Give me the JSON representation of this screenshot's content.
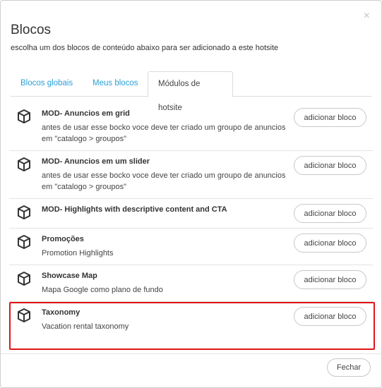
{
  "modal": {
    "close_glyph": "×",
    "title": "Blocos",
    "subtitle": "escolha um dos blocos de conteúdo abaixo para ser adicionado a este hotsite"
  },
  "tabs": [
    {
      "label": "Blocos globais",
      "active": false
    },
    {
      "label": "Meus blocos",
      "active": false
    },
    {
      "label": "Módulos de hotsite",
      "active": true
    }
  ],
  "add_button_label": "adicionar bloco",
  "blocks": [
    {
      "name": "MOD- Anuncios em grid",
      "description": "antes de usar esse bocko voce deve ter criado um groupo de anuncios em \"catalogo > groupos\"",
      "icon": "cube-icon"
    },
    {
      "name": "MOD- Anuncios em um slider",
      "description": "antes de usar esse bocko voce deve ter criado um groupo de anuncios em \"catalogo > groupos\"",
      "icon": "cube-icon"
    },
    {
      "name": "MOD- Highlights with descriptive content and CTA",
      "description": "",
      "icon": "cube-icon"
    },
    {
      "name": "Promoções",
      "description": "Promotion Highlights",
      "icon": "cube-icon"
    },
    {
      "name": "Showcase Map",
      "description": "Mapa Google como plano de fundo",
      "icon": "cube-icon"
    },
    {
      "name": "Taxonomy",
      "description": "Vacation rental taxonomy",
      "icon": "cube-icon"
    }
  ],
  "footer": {
    "close_label": "Fechar"
  },
  "colors": {
    "tab_link": "#2a9fd6",
    "highlight_border": "#e0141a"
  }
}
